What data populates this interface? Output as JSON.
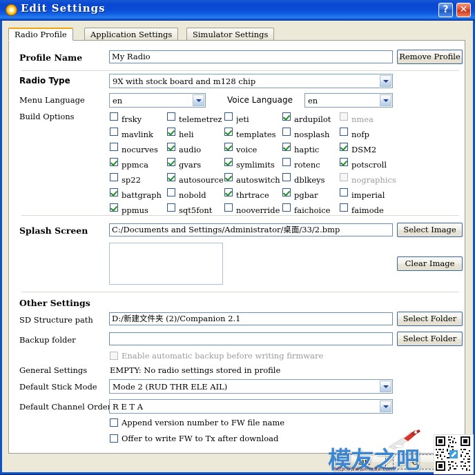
{
  "window": {
    "title": "Edit Settings",
    "icon": "gear-icon",
    "help_label": "?",
    "close_label": "✕",
    "titlebar_color": "#0a48d0"
  },
  "tabs": [
    {
      "label": "Radio Profile",
      "active": true
    },
    {
      "label": "Application Settings",
      "active": false
    },
    {
      "label": "Simulator Settings",
      "active": false
    }
  ],
  "profile": {
    "name_label": "Profile Name",
    "name_value": "My Radio",
    "remove_button": "Remove Profile"
  },
  "radio": {
    "type_label": "Radio Type",
    "type_value": "9X with stock board and m128 chip",
    "menu_language_label": "Menu Language",
    "menu_language_value": "en",
    "voice_language_label": "Voice Language",
    "voice_language_value": "en"
  },
  "build_options": {
    "label": "Build Options",
    "columns": [
      {
        "items": [
          {
            "label": "frsky",
            "checked": false
          },
          {
            "label": "mavlink",
            "checked": false
          },
          {
            "label": "nocurves",
            "checked": false
          },
          {
            "label": "ppmca",
            "checked": true
          },
          {
            "label": "sp22",
            "checked": false
          },
          {
            "label": "battgraph",
            "checked": true
          },
          {
            "label": "ppmus",
            "checked": true
          }
        ]
      },
      {
        "items": [
          {
            "label": "telemetrez",
            "checked": false
          },
          {
            "label": "heli",
            "checked": true
          },
          {
            "label": "audio",
            "checked": true
          },
          {
            "label": "gvars",
            "checked": true
          },
          {
            "label": "autosource",
            "checked": true
          },
          {
            "label": "nobold",
            "checked": false
          },
          {
            "label": "sqt5font",
            "checked": false
          }
        ]
      },
      {
        "items": [
          {
            "label": "jeti",
            "checked": false
          },
          {
            "label": "templates",
            "checked": true
          },
          {
            "label": "voice",
            "checked": true
          },
          {
            "label": "symlimits",
            "checked": true
          },
          {
            "label": "autoswitch",
            "checked": true
          },
          {
            "label": "thrtrace",
            "checked": true
          },
          {
            "label": "nooverride",
            "checked": false
          }
        ]
      },
      {
        "items": [
          {
            "label": "ardupilot",
            "checked": true
          },
          {
            "label": "nosplash",
            "checked": false
          },
          {
            "label": "haptic",
            "checked": true
          },
          {
            "label": "rotenc",
            "checked": false
          },
          {
            "label": "dblkeys",
            "checked": false
          },
          {
            "label": "pgbar",
            "checked": true
          },
          {
            "label": "faichoice",
            "checked": false
          }
        ]
      },
      {
        "items": [
          {
            "label": "nmea",
            "checked": false,
            "disabled": true
          },
          {
            "label": "nofp",
            "checked": false
          },
          {
            "label": "DSM2",
            "checked": true
          },
          {
            "label": "potscroll",
            "checked": true
          },
          {
            "label": "nographics",
            "checked": false,
            "disabled": true
          },
          {
            "label": "imperial",
            "checked": false
          },
          {
            "label": "faimode",
            "checked": false
          }
        ]
      }
    ]
  },
  "splash": {
    "label": "Splash Screen",
    "path_value": "C:/Documents and Settings/Administrator/桌面/33/2.bmp",
    "select_button": "Select Image",
    "clear_button": "Clear Image"
  },
  "other": {
    "heading": "Other Settings",
    "sd_label": "SD Structure path",
    "sd_value": "D:/新建文件夹 (2)/Companion 2.1",
    "sd_button": "Select Folder",
    "backup_label": "Backup folder",
    "backup_value": "",
    "backup_button": "Select Folder",
    "auto_backup_label": "Enable automatic backup before writing firmware",
    "auto_backup_checked": false,
    "general_label": "General Settings",
    "general_value": "EMPTY: No radio settings stored in profile",
    "stick_mode_label": "Default Stick Mode",
    "stick_mode_value": "Mode 2 (RUD THR ELE AIL)",
    "channel_order_label": "Default Channel Order",
    "channel_order_value": "R E T A",
    "append_version_label": "Append version number to FW file name",
    "append_version_checked": false,
    "offer_write_label": "Offer to write FW to Tx after download",
    "offer_write_checked": false
  },
  "footer": {
    "ok_button": "OK",
    "cancel_button": "C"
  },
  "watermark": {
    "text": "模友之吧",
    "url": "http://www.mo88.com",
    "qr": "qr-code",
    "plane": "airplane-graphic"
  }
}
